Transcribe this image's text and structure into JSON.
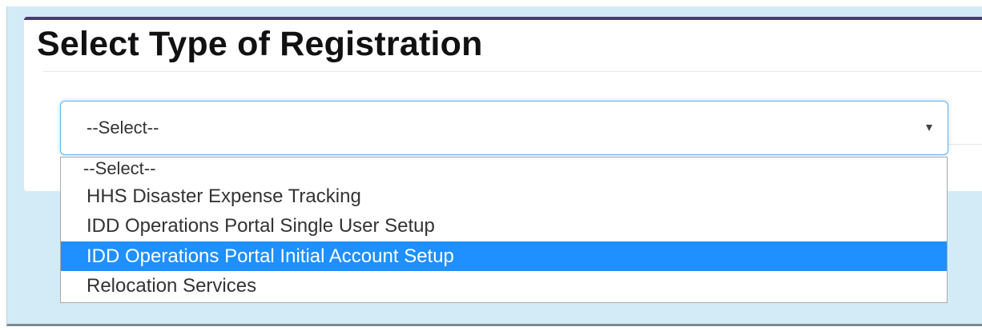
{
  "panel": {
    "title": "Select Type of Registration"
  },
  "registration_select": {
    "value": "--Select--",
    "options": [
      "--Select--",
      "HHS Disaster Expense Tracking",
      "IDD Operations Portal Single User Setup",
      "IDD Operations Portal Initial Account Setup",
      "Relocation Services"
    ],
    "highlighted_option": "IDD Operations Portal Initial Account Setup",
    "highlight_color": "#1e90ff"
  },
  "colors": {
    "page_background": "#d3ebf6",
    "panel_border_top": "#4b3a78",
    "focus_border": "#66afe9"
  },
  "icons": {
    "dropdown": "caret-down-icon"
  }
}
